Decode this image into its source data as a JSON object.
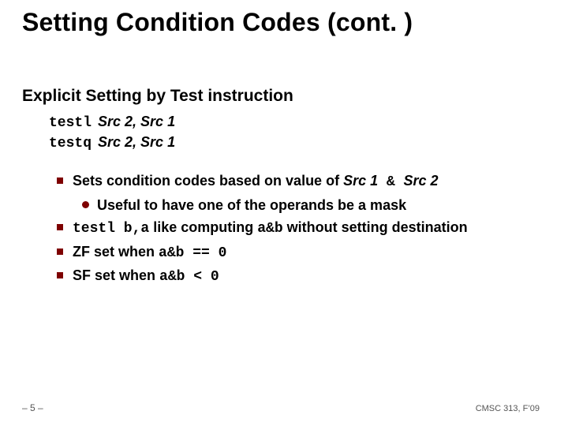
{
  "title": "Setting Condition Codes (cont. )",
  "subtitle": "Explicit Setting by Test instruction",
  "instr": {
    "l_cmd": "testl",
    "l_args": "Src 2, Src 1",
    "q_cmd": "testq",
    "q_args": "Src 2, Src 1"
  },
  "b1": {
    "pre": "Sets condition codes based on value of ",
    "s1": "Src 1",
    "amp": " & ",
    "s2": "Src 2"
  },
  "b1a": "Useful to have one of the operands be a mask",
  "b2": {
    "cmd": "testl b,a",
    "mid": "  like computing  ",
    "expr": "a&b",
    "post": "  without setting destination"
  },
  "b3": {
    "pre": "ZF set when  ",
    "expr": "a&b == 0"
  },
  "b4": {
    "pre": "SF set when  ",
    "expr": "a&b < 0"
  },
  "footer": {
    "left": "– 5 –",
    "right": "CMSC 313, F’09"
  }
}
